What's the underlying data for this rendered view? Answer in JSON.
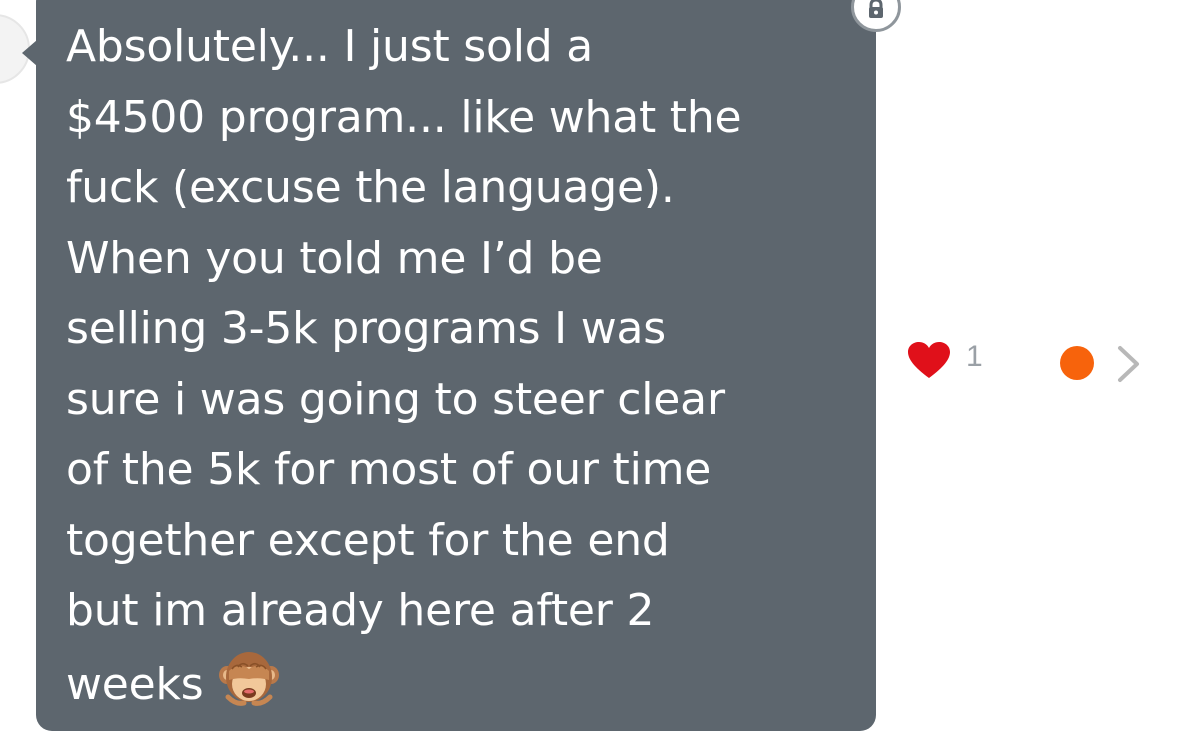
{
  "message": {
    "text": "Absolutely... I just sold a\n$4500 program... like what the\nfuck (excuse the language).\nWhen you told me I’d be\nselling 3-5k programs I was\nsure i was going to steer clear\nof the 5k for most of our time\ntogether except for the end\nbut im already here after 2\nweeks",
    "emoji": "see-no-evil-monkey-icon",
    "bubble_color": "#5d666e"
  },
  "reactions": {
    "like_count": "1",
    "heart_icon": "heart-icon",
    "heart_color": "#e0101a",
    "status_icon": "orange-dot-icon",
    "status_color": "#f7630c",
    "chevron_icon": "chevron-right-icon"
  },
  "lock_badge": {
    "icon": "lock-icon"
  }
}
